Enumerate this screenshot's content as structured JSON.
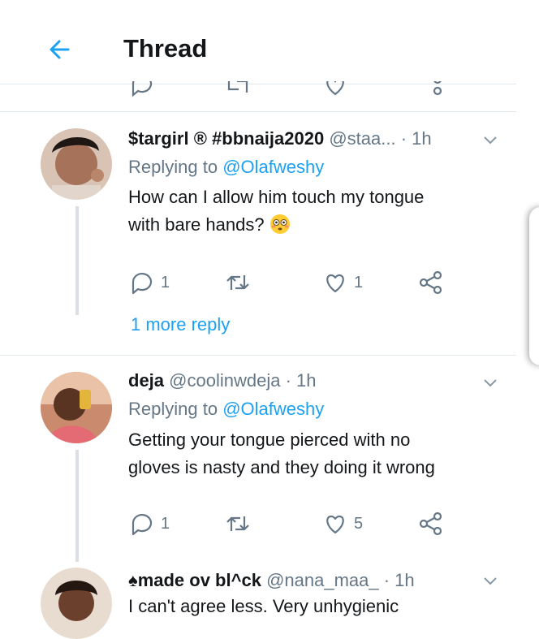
{
  "header": {
    "title": "Thread",
    "back_icon": "arrow-left-icon",
    "accent": "#1da1f2"
  },
  "tweets": [
    {
      "name": "$targirl ® #bbnaija2020",
      "handle": "@staa...",
      "time": "· 1h",
      "replying_prefix": "Replying to",
      "replying_to": "@Olafweshy",
      "text_line1": "How can I allow him touch my tongue",
      "text_line2": "with bare hands?",
      "emoji": "flushed-face-emoji",
      "reply_count": "1",
      "like_count": "1",
      "more_replies": "1 more reply"
    },
    {
      "name": "deja",
      "handle": "@coolinwdeja",
      "time": "· 1h",
      "replying_prefix": "Replying to",
      "replying_to": "@Olafweshy",
      "text_line1": "Getting your tongue pierced with no",
      "text_line2": "gloves is nasty and they doing it wrong",
      "reply_count": "1",
      "like_count": "5"
    },
    {
      "name": "made ov bl^ck",
      "handle": "@nana_maa_",
      "time": "· 1h",
      "text_line1": "I can't agree less. Very unhygienic"
    }
  ],
  "colors": {
    "text": "#14171a",
    "muted": "#657786",
    "link": "#1da1f2",
    "divider": "#e1e8ed"
  }
}
